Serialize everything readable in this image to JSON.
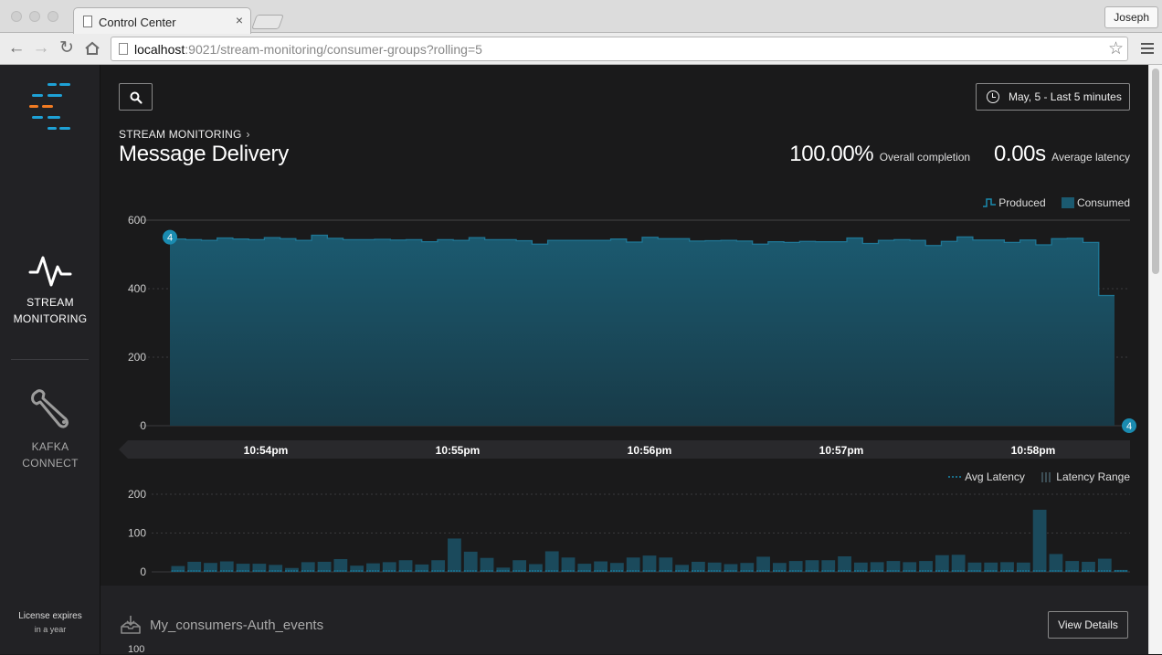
{
  "browser": {
    "tab_title": "Control Center",
    "tab_close": "×",
    "profile_name": "Joseph",
    "url_host": "localhost",
    "url_rest": ":9021/stream-monitoring/consumer-groups?rolling=5",
    "star": "☆"
  },
  "sidebar": {
    "items": [
      {
        "line1": "STREAM",
        "line2": "MONITORING",
        "icon": "activity-pulse-icon",
        "active": true
      },
      {
        "line1": "KAFKA",
        "line2": "CONNECT",
        "icon": "wrench-icon",
        "active": false
      }
    ],
    "license_line1": "License expires",
    "license_line2": "in a year"
  },
  "header": {
    "breadcrumb": "STREAM MONITORING",
    "breadcrumb_chevron": "›",
    "title": "Message Delivery",
    "time_range": "May, 5 - Last 5 minutes",
    "completion_value": "100.00%",
    "completion_label": "Overall completion",
    "latency_value": "0.00s",
    "latency_label": "Average latency"
  },
  "colors": {
    "accent": "#1a8bb0",
    "area_top": "#1b5a70",
    "area_bottom": "#183a47",
    "logo_blue": "#1ea1d6",
    "logo_orange": "#f27b22"
  },
  "delivery_chart": {
    "legend_produced": "Produced",
    "legend_consumed": "Consumed",
    "y_ticks": [
      "600",
      "400",
      "200",
      "0"
    ],
    "y_max": 600,
    "start_marker": "4",
    "end_marker": "4",
    "time_labels": [
      "10:54pm",
      "10:55pm",
      "10:56pm",
      "10:57pm",
      "10:58pm"
    ],
    "values": [
      545,
      543,
      541,
      548,
      545,
      543,
      549,
      546,
      541,
      556,
      547,
      543,
      543,
      544,
      542,
      543,
      537,
      543,
      541,
      549,
      543,
      543,
      540,
      530,
      541,
      541,
      541,
      541,
      545,
      536,
      550,
      546,
      546,
      539,
      540,
      541,
      539,
      530,
      537,
      535,
      538,
      537,
      537,
      548,
      532,
      541,
      543,
      541,
      526,
      538,
      551,
      542,
      542,
      535,
      542,
      528,
      546,
      547,
      535,
      380
    ]
  },
  "latency_chart": {
    "legend_avg": "Avg Latency",
    "legend_range": "Latency Range",
    "y_ticks": [
      "200",
      "100",
      "0"
    ],
    "y_max": 200,
    "values": [
      15,
      26,
      23,
      27,
      21,
      21,
      18,
      10,
      25,
      26,
      33,
      16,
      22,
      25,
      30,
      19,
      30,
      86,
      52,
      36,
      11,
      30,
      20,
      53,
      37,
      21,
      27,
      23,
      37,
      42,
      37,
      18,
      26,
      24,
      20,
      23,
      39,
      23,
      28,
      30,
      30,
      40,
      24,
      25,
      28,
      25,
      28,
      43,
      44,
      24,
      24,
      25,
      24,
      160,
      46,
      28,
      26,
      34,
      5
    ]
  },
  "consumer": {
    "name": "My_consumers-Auth_events",
    "view_details": "View Details",
    "y_top": "100"
  }
}
